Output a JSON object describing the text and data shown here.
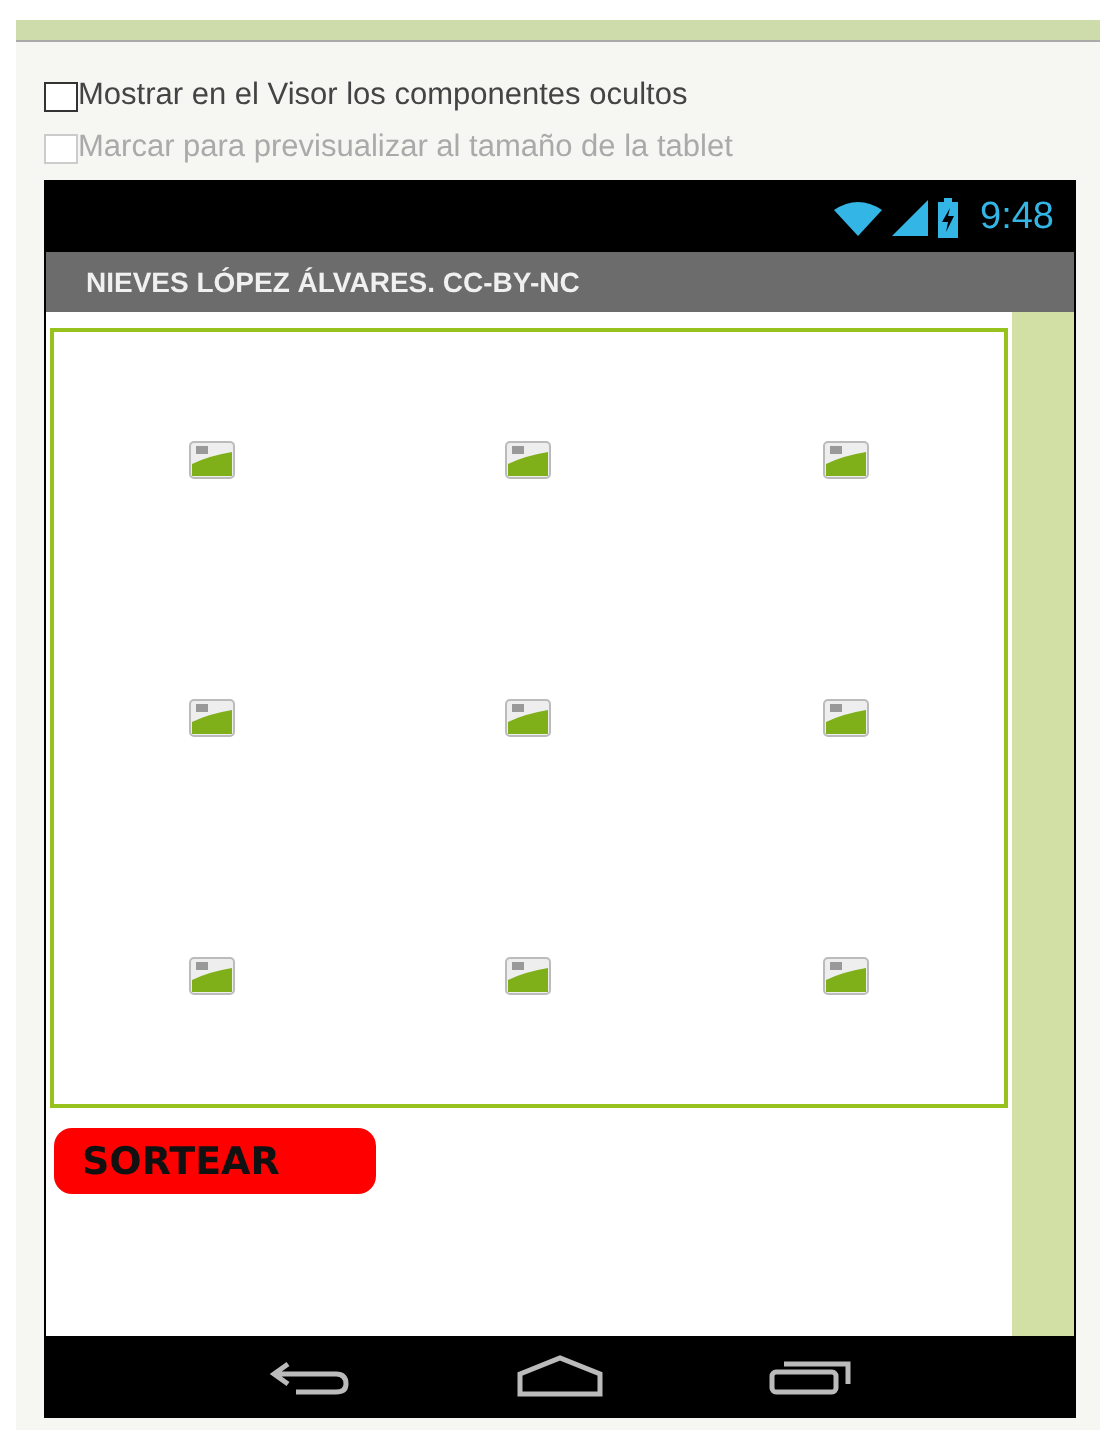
{
  "options": [
    {
      "label": "Mostrar en el Visor los componentes ocultos",
      "checked": false,
      "disabled": false
    },
    {
      "label": "Marcar para previsualizar al tamaño de la tablet",
      "checked": false,
      "disabled": true
    }
  ],
  "phone": {
    "status_bar": {
      "time": "9:48"
    },
    "title": "NIEVES LÓPEZ ÁLVARES. CC-BY-NC",
    "button": "SORTEAR"
  }
}
